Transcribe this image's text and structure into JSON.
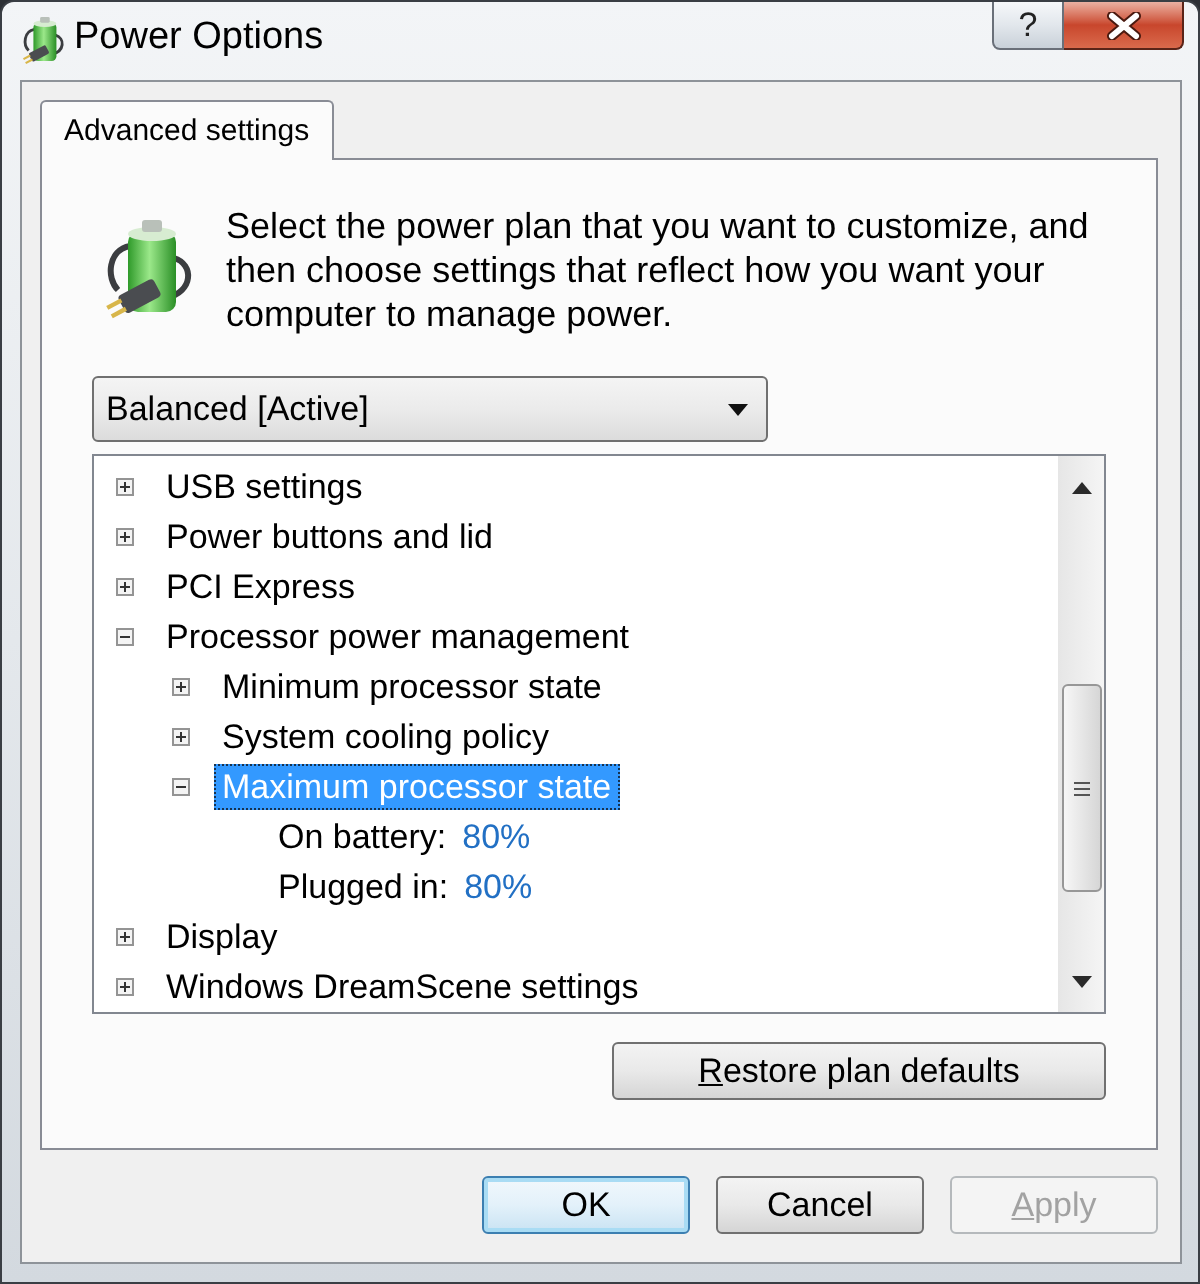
{
  "window": {
    "title": "Power Options",
    "title_buttons": [
      {
        "kind": "help",
        "label": "?"
      },
      {
        "kind": "close"
      }
    ]
  },
  "tabs": [
    {
      "label": "Advanced settings",
      "selected": true
    }
  ],
  "description": "Select the power plan that you want to customize, and then choose settings that reflect how you want your computer to manage power.",
  "plan_dropdown": {
    "value": "Balanced [Active]"
  },
  "settings_tree": {
    "items": [
      {
        "kind": "group",
        "label": "USB settings",
        "expanded": false,
        "selected": false
      },
      {
        "kind": "group",
        "label": "Power buttons and lid",
        "expanded": false,
        "selected": false
      },
      {
        "kind": "group",
        "label": "PCI Express",
        "expanded": false,
        "selected": false
      },
      {
        "kind": "group",
        "label": "Processor power management",
        "expanded": true,
        "selected": false,
        "children": [
          {
            "kind": "group",
            "label": "Minimum processor state",
            "expanded": false,
            "selected": false
          },
          {
            "kind": "group",
            "label": "System cooling policy",
            "expanded": false,
            "selected": false
          },
          {
            "kind": "group",
            "label": "Maximum processor state",
            "expanded": true,
            "selected": true,
            "children": [
              {
                "kind": "value",
                "label": "On battery:",
                "value": "80%",
                "selected": false
              },
              {
                "kind": "value",
                "label": "Plugged in:",
                "value": "80%",
                "selected": false
              }
            ]
          }
        ]
      },
      {
        "kind": "group",
        "label": "Display",
        "expanded": false,
        "selected": false
      },
      {
        "kind": "group",
        "label": "Windows DreamScene settings",
        "expanded": false,
        "selected": false
      }
    ]
  },
  "restore_button": {
    "label": "Restore plan defaults",
    "mnemonic": true
  },
  "buttons": [
    {
      "label": "OK",
      "default": true,
      "disabled": false,
      "mnemonic": false
    },
    {
      "label": "Cancel",
      "default": false,
      "disabled": false,
      "mnemonic": false
    },
    {
      "label": "Apply",
      "default": false,
      "disabled": true,
      "mnemonic": true
    }
  ]
}
